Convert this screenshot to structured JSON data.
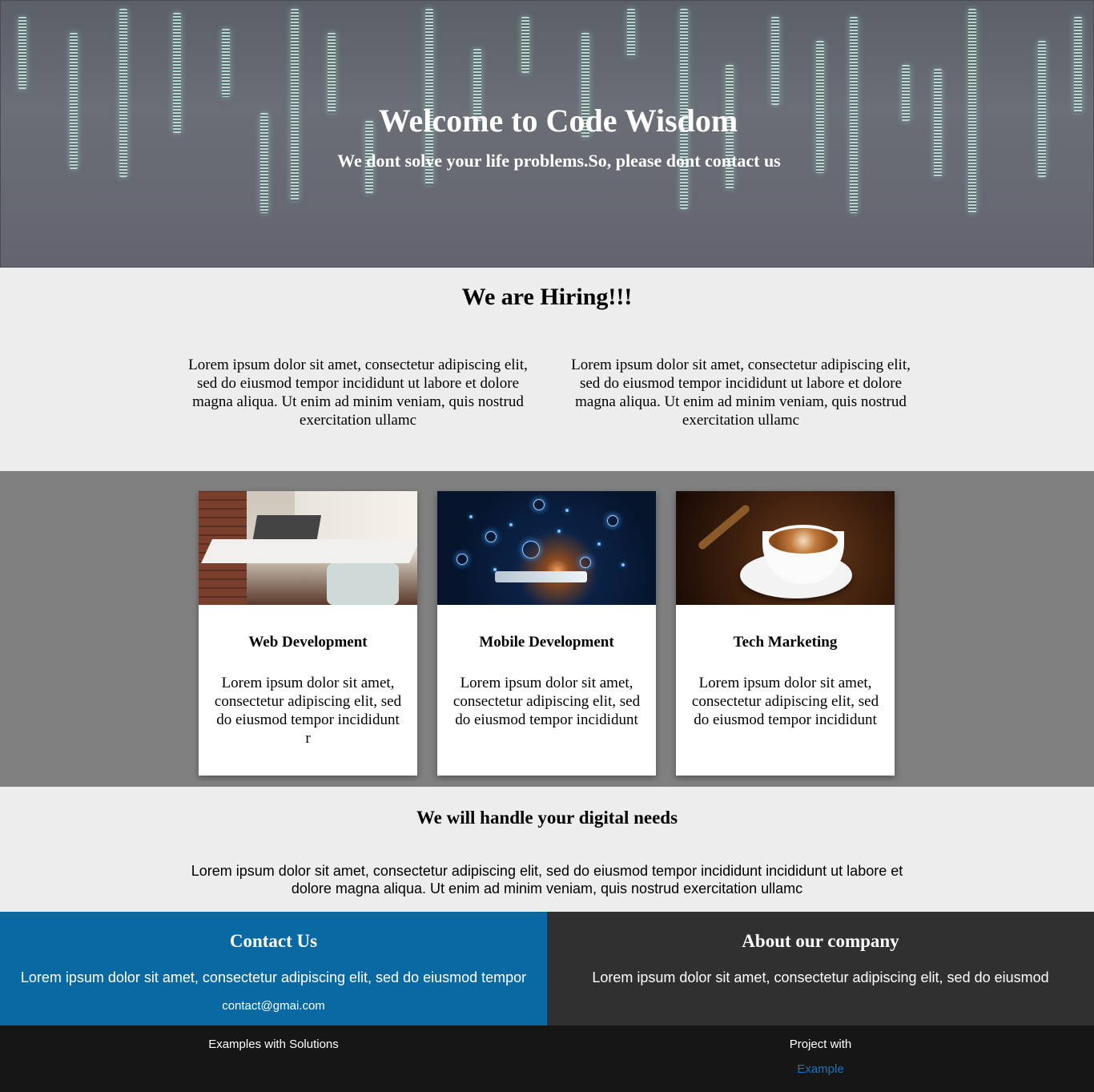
{
  "hero": {
    "title": "Welcome to Code Wisdom",
    "subtitle": "We dont solve your life problems.So, please dont contact us"
  },
  "hiring": {
    "title": "We are Hiring!!!",
    "columns": [
      "Lorem ipsum dolor sit amet, consectetur adipiscing elit, sed do eiusmod tempor incididunt ut labore et dolore magna aliqua. Ut enim ad minim veniam, quis nostrud exercitation ullamc",
      "Lorem ipsum dolor sit amet, consectetur adipiscing elit, sed do eiusmod tempor incididunt ut labore et dolore magna aliqua. Ut enim ad minim veniam, quis nostrud exercitation ullamc"
    ]
  },
  "services": {
    "cards": [
      {
        "title": "Web Development",
        "text": "Lorem ipsum dolor sit amet, consectetur adipiscing elit, sed do eiusmod tempor incididunt r"
      },
      {
        "title": "Mobile Development",
        "text": "Lorem ipsum dolor sit amet, consectetur adipiscing elit, sed do eiusmod tempor incididunt"
      },
      {
        "title": "Tech Marketing",
        "text": "Lorem ipsum dolor sit amet, consectetur adipiscing elit, sed do eiusmod tempor incididunt"
      }
    ]
  },
  "digital": {
    "title": "We will handle your digital needs",
    "text": "Lorem ipsum dolor sit amet, consectetur adipiscing elit, sed do eiusmod tempor incididunt incididunt ut labore et dolore magna aliqua. Ut enim ad minim veniam, quis nostrud exercitation ullamc"
  },
  "contact": {
    "title": "Contact Us",
    "text": "Lorem ipsum dolor sit amet, consectetur adipiscing elit, sed do eiusmod tempor",
    "email": "contact@gmai.com",
    "color": "#0869a3"
  },
  "about": {
    "title": "About our company",
    "text": "Lorem ipsum dolor sit amet, consectetur adipiscing elit, sed do eiusmod",
    "color": "#303030"
  },
  "footer": {
    "left_text": "Examples with Solutions",
    "right_text": "Project with",
    "right_link": "Example",
    "link_color": "#1a73c4"
  }
}
